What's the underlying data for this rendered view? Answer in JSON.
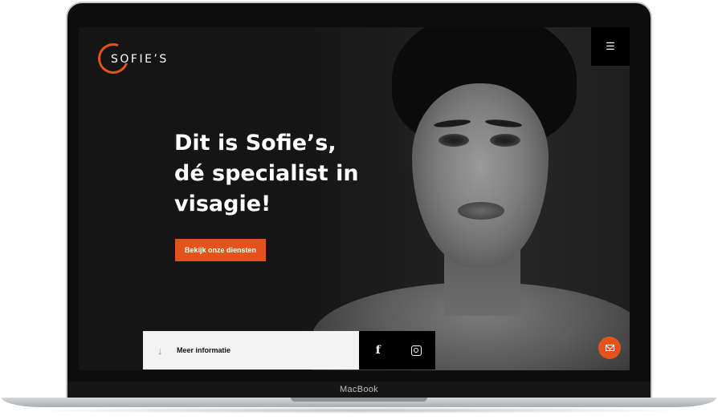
{
  "device": {
    "label": "MacBook"
  },
  "header": {
    "logo_text": "SOFIE’S",
    "menu_icon": "hamburger-menu-icon"
  },
  "hero": {
    "title_lines": [
      "Dit is Sofie’s,",
      "dé specialist in",
      "visagie!"
    ],
    "cta_label": "Bekijk onze diensten"
  },
  "bottom_bar": {
    "info_label": "Meer informatie",
    "info_icon": "arrow-down-icon",
    "social": [
      "facebook-icon",
      "instagram-icon"
    ]
  },
  "floating": {
    "mail_icon": "mail-icon"
  },
  "colors": {
    "accent": "#e5531c",
    "background": "#151515",
    "bar_light": "#f3f3f3"
  }
}
